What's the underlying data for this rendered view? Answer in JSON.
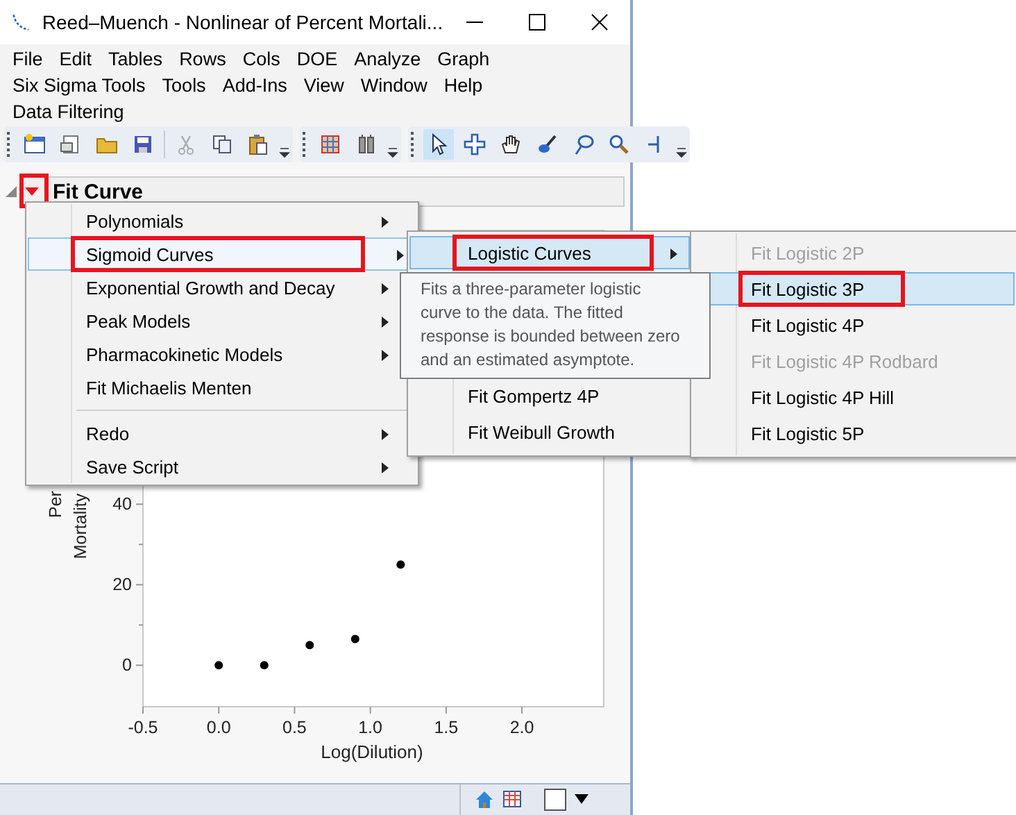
{
  "window": {
    "title": "Reed–Muench - Nonlinear of Percent Mortali..."
  },
  "menu_bar": [
    [
      "File",
      "Edit",
      "Tables",
      "Rows",
      "Cols",
      "DOE",
      "Analyze",
      "Graph"
    ],
    [
      "Six Sigma Tools",
      "Tools",
      "Add-Ins",
      "View",
      "Window",
      "Help"
    ],
    [
      "Data Filtering"
    ]
  ],
  "report": {
    "title": "Fit Curve",
    "expanded": true,
    "callout": true,
    "chart_data": {
      "type": "scatter",
      "xlabel": "Log(Dilution)",
      "ylabel": "Per Mortality",
      "x": [
        0,
        0.3,
        0.6,
        0.9,
        1.2
      ],
      "series": [
        {
          "color": "#000000",
          "values": [
            0,
            0,
            5,
            6.5,
            25
          ]
        }
      ],
      "xlim": [
        -0.5,
        2.54
      ],
      "ylim": [
        -10.3,
        108
      ],
      "xticks": [
        {
          "value": -0.5,
          "label": "-0.5"
        },
        {
          "value": 0,
          "label": "0.0"
        },
        {
          "value": 0.5,
          "label": "0.5"
        },
        {
          "value": 1,
          "label": "1.0"
        },
        {
          "value": 1.5,
          "label": "1.5"
        },
        {
          "value": 2,
          "label": "2.0"
        }
      ],
      "yticks": [
        0,
        20,
        40
      ]
    }
  },
  "menus": [
    {
      "items": [
        {
          "kind": "item",
          "label": "Polynomials",
          "submenu": true,
          "selected": false,
          "disabled": false,
          "callout": false
        },
        {
          "kind": "item",
          "label": "Sigmoid Curves",
          "submenu": true,
          "selected": true,
          "disabled": false,
          "callout": true
        },
        {
          "kind": "item",
          "label": "Exponential Growth and Decay",
          "submenu": true,
          "selected": false,
          "disabled": false,
          "callout": false
        },
        {
          "kind": "item",
          "label": "Peak Models",
          "submenu": true,
          "selected": false,
          "disabled": false,
          "callout": false
        },
        {
          "kind": "item",
          "label": "Pharmacokinetic Models",
          "submenu": true,
          "selected": false,
          "disabled": false,
          "callout": false
        },
        {
          "kind": "item",
          "label": "Fit Michaelis Menten",
          "submenu": false,
          "selected": false,
          "disabled": false,
          "callout": false
        },
        {
          "kind": "separator"
        },
        {
          "kind": "item",
          "label": "Redo",
          "submenu": true,
          "selected": false,
          "disabled": false,
          "callout": false
        },
        {
          "kind": "item",
          "label": "Save Script",
          "submenu": true,
          "selected": false,
          "disabled": false,
          "callout": false
        }
      ]
    },
    {
      "tooltip": "Fits a three-parameter logistic curve to the data. The fitted response is bounded between zero and an estimated asymptote.",
      "items": [
        {
          "kind": "item",
          "label": "Logistic Curves",
          "submenu": true,
          "selected": true,
          "disabled": false,
          "callout": true
        },
        {
          "kind": "item",
          "label": "Fit Gompertz 4P",
          "submenu": false,
          "selected": false,
          "disabled": false,
          "callout": false
        },
        {
          "kind": "item",
          "label": "Fit Weibull Growth",
          "submenu": false,
          "selected": false,
          "disabled": false,
          "callout": false
        }
      ]
    },
    {
      "items": [
        {
          "kind": "item",
          "label": "Fit Logistic 2P",
          "submenu": false,
          "selected": false,
          "disabled": true,
          "callout": false
        },
        {
          "kind": "item",
          "label": "Fit Logistic 3P",
          "submenu": false,
          "selected": true,
          "disabled": false,
          "callout": true
        },
        {
          "kind": "item",
          "label": "Fit Logistic 4P",
          "submenu": false,
          "selected": false,
          "disabled": false,
          "callout": false
        },
        {
          "kind": "item",
          "label": "Fit Logistic 4P Rodbard",
          "submenu": false,
          "selected": false,
          "disabled": true,
          "callout": false
        },
        {
          "kind": "item",
          "label": "Fit Logistic 4P Hill",
          "submenu": false,
          "selected": false,
          "disabled": false,
          "callout": false
        },
        {
          "kind": "item",
          "label": "Fit Logistic 5P",
          "submenu": false,
          "selected": false,
          "disabled": false,
          "callout": false
        }
      ]
    }
  ]
}
